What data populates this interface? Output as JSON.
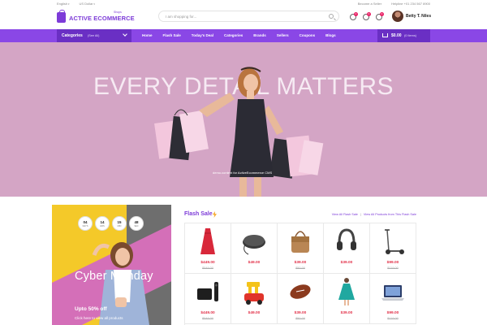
{
  "topbar": {
    "language": "English",
    "currency": "US Dollar",
    "become_seller": "Become a Seller",
    "helpline": "Helpline +01 234 567 8900"
  },
  "header": {
    "logo_text": "ACTIVE ECOMMERCE",
    "logo_sup": "Shops",
    "search_placeholder": "I am shopping for...",
    "compare_count": "0",
    "wishlist_count": "0",
    "notify_count": "0",
    "username": "Betty T. Niles"
  },
  "nav": {
    "categories_title": "Categories",
    "categories_sub": "(See All)",
    "links": [
      "Home",
      "Flash Sale",
      "Today's Deal",
      "Categories",
      "Brands",
      "Sellers",
      "Coupons",
      "Blogs"
    ],
    "cart_amount": "$0.00",
    "cart_items": "(0 Items)"
  },
  "hero": {
    "title": "EVERY DETAIL MATTERS",
    "credit": "demo.content for ActiveEcommerce CMS",
    "background": "#d4a5c5"
  },
  "promo": {
    "countdown": [
      {
        "value": "04",
        "unit": "DAYS"
      },
      {
        "value": "14",
        "unit": "HRS"
      },
      {
        "value": "15",
        "unit": "MIN"
      },
      {
        "value": "48",
        "unit": "SEC"
      }
    ],
    "title": "Cyber Monday",
    "offer": "Upto 50% off",
    "link": "Click here to view all products"
  },
  "flash_sale": {
    "title": "Flash Sale",
    "view_all": "View All Flash Sale",
    "view_products": "View All Products from This Flash Sale",
    "products": [
      {
        "name": "red-dress",
        "price": "$449.00",
        "old": "$549.00"
      },
      {
        "name": "wireless-charger",
        "price": "$49.00",
        "old": ""
      },
      {
        "name": "leather-bag",
        "price": "$39.00",
        "old": "$50.00"
      },
      {
        "name": "headphones",
        "price": "$39.00",
        "old": ""
      },
      {
        "name": "electric-scooter",
        "price": "$99.00",
        "old": "$119.00"
      },
      {
        "name": "apple-tv",
        "price": "$449.00",
        "old": "$549.00"
      },
      {
        "name": "toy-car",
        "price": "$49.00",
        "old": ""
      },
      {
        "name": "football",
        "price": "$39.00",
        "old": "$50.00"
      },
      {
        "name": "teal-dress",
        "price": "$39.00",
        "old": ""
      },
      {
        "name": "laptop",
        "price": "$99.00",
        "old": "$119.00"
      }
    ]
  },
  "colors": {
    "brand": "#7d3bd8",
    "nav": "#8a47e6",
    "nav_dark": "#6a2fc4",
    "price": "#e2324a"
  }
}
